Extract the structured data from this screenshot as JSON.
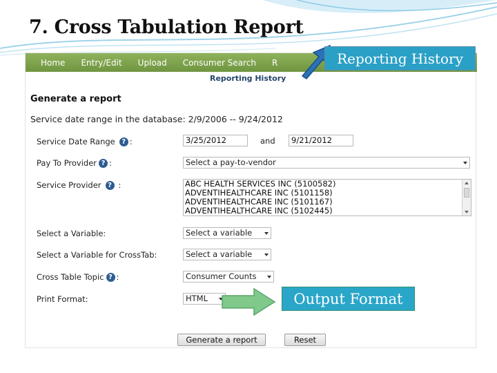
{
  "slide": {
    "title": "7. Cross Tabulation Report"
  },
  "nav": {
    "items": [
      "Home",
      "Entry/Edit",
      "Upload",
      "Consumer Search",
      "R"
    ],
    "sub_item": "Reporting History"
  },
  "callouts": {
    "history": "Reporting History",
    "output": "Output  Format"
  },
  "form": {
    "heading": "Generate a report",
    "date_range_info": "Service date range in the database: 2/9/2006 -- 9/24/2012",
    "service_date_range": {
      "label": "Service Date Range",
      "start": "3/25/2012",
      "joiner": "and",
      "end": "9/21/2012"
    },
    "pay_to_provider": {
      "label": "Pay To Provider",
      "value": "Select a pay-to-vendor"
    },
    "service_provider": {
      "label": "Service Provider",
      "options": [
        "ABC HEALTH SERVICES INC (5100582)",
        "ADVENTIHEALTHCARE INC (5101158)",
        "ADVENTIHEALTHCARE INC (5101167)",
        "ADVENTIHEALTHCARE INC (5102445)"
      ]
    },
    "variable": {
      "label": "Select a Variable:",
      "value": "Select a variable"
    },
    "crosstab_variable": {
      "label": "Select a Variable for CrossTab:",
      "value": "Select a variable"
    },
    "cross_table_topic": {
      "label": "Cross Table Topic",
      "value": "Consumer Counts"
    },
    "print_format": {
      "label": "Print Format:",
      "value": "HTML"
    },
    "buttons": {
      "generate": "Generate a report",
      "reset": "Reset"
    }
  },
  "icons": {
    "help": "question-mark-icon",
    "help_char": "?",
    "colon": ":"
  },
  "colors": {
    "nav_green": "#7aa04a",
    "callout_blue": "#2aa0c6",
    "arrow_blue": "#2a72b8",
    "arrow_green": "#7fc98a"
  }
}
